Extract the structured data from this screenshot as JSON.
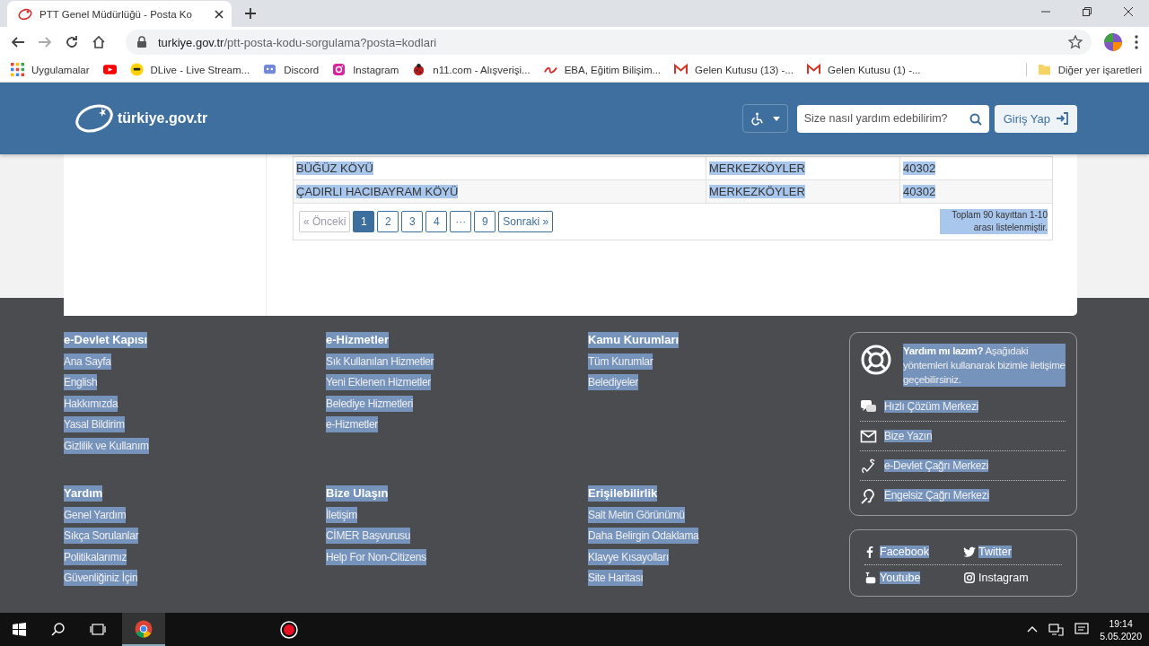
{
  "browser": {
    "tab_title": "PTT Genel Müdürlüğü - Posta Ko",
    "url_host": "turkiye.gov.tr",
    "url_path": "/ptt-posta-kodu-sorgulama?posta=kodlari",
    "bookmarks": [
      {
        "kind": "link",
        "label": "Uygulamalar"
      },
      {
        "kind": "icon"
      },
      {
        "kind": "link",
        "label": "DLive - Live Stream..."
      },
      {
        "kind": "link",
        "label": "Discord"
      },
      {
        "kind": "link",
        "label": "Instagram"
      },
      {
        "kind": "link",
        "label": "n11.com - Alışverişi..."
      },
      {
        "kind": "link",
        "label": "EBA, Eğitim Bilişim..."
      },
      {
        "kind": "link",
        "label": "Gelen Kutusu (13) -..."
      },
      {
        "kind": "link",
        "label": "Gelen Kutusu (1) -..."
      }
    ],
    "other_bookmarks": "Diğer yer işaretleri"
  },
  "header": {
    "logo_text": "türkiye.gov.tr",
    "search_placeholder": "Size nasıl yardım edebilirim?",
    "login": "Giriş Yap"
  },
  "selection_highlight": true,
  "table": {
    "rows": [
      {
        "cells": [
          "BÜĞÜZ KÖYÜ",
          "MERKEZKÖYLER",
          "40302"
        ]
      },
      {
        "cells": [
          "ÇADIRLI HACIBAYRAM KÖYÜ",
          "MERKEZKÖYLER",
          "40302"
        ]
      }
    ]
  },
  "pagination": {
    "prev": {
      "label": "« Önceki",
      "disabled": true
    },
    "pages": [
      {
        "label": "1",
        "selected": true
      },
      {
        "label": "2",
        "selected": false
      },
      {
        "label": "3",
        "selected": false
      },
      {
        "label": "4",
        "selected": false
      },
      {
        "label": "···",
        "selected": false
      },
      {
        "label": "9",
        "selected": false
      }
    ],
    "next": "Sonraki »",
    "summary": "Toplam 90 kayıttan 1-10 arası listelenmiştir."
  },
  "footer": {
    "sections": [
      {
        "heading": "e-Devlet Kapısı",
        "links": [
          "Ana Sayfa",
          "English",
          "Hakkımızda",
          "Yasal Bildirim",
          "Gizlilik ve Kullanım"
        ]
      },
      {
        "heading": "e-Hizmetler",
        "links": [
          "Sık Kullanılan Hizmetler",
          "Yeni Eklenen Hizmetler",
          "Belediye Hizmetleri",
          "e-Hizmetler"
        ]
      },
      {
        "heading": "Kamu Kurumları",
        "links": [
          "Tüm Kurumlar",
          "Belediyeler"
        ]
      },
      {
        "heading": "Yardım",
        "links": [
          "Genel Yardım",
          "Sıkça Sorulanlar",
          "Politikalarımız",
          "Güvenliğiniz İçin"
        ]
      },
      {
        "heading": "Bize Ulaşın",
        "links": [
          "İletişim",
          "CİMER Başvurusu",
          "Help For Non-Citizens"
        ]
      },
      {
        "heading": "Erişilebilirlik",
        "links": [
          "Salt Metin Görünümü",
          "Daha Belirgin Odaklama",
          "Klavye Kısayolları",
          "Site Haritası"
        ]
      }
    ],
    "help": {
      "text": "**Yardım mı lazım?** Aşağıdaki yöntemleri kullanarak bizimle iletişime geçebilirsiniz.",
      "items": [
        "Hızlı Çözüm Merkezi",
        "Bize Yazın",
        "e-Devlet Çağrı Merkezi",
        "Engelsiz Çağrı Merkezi"
      ]
    },
    "social": [
      {
        "label": "Facebook",
        "highlighted": true
      },
      {
        "label": "Twitter",
        "highlighted": true
      },
      {
        "label": "Youtube",
        "highlighted": true
      },
      {
        "label": "Instagram",
        "highlighted": false
      }
    ]
  },
  "taskbar": {
    "time": "19:14",
    "date": "5.05.2020"
  }
}
